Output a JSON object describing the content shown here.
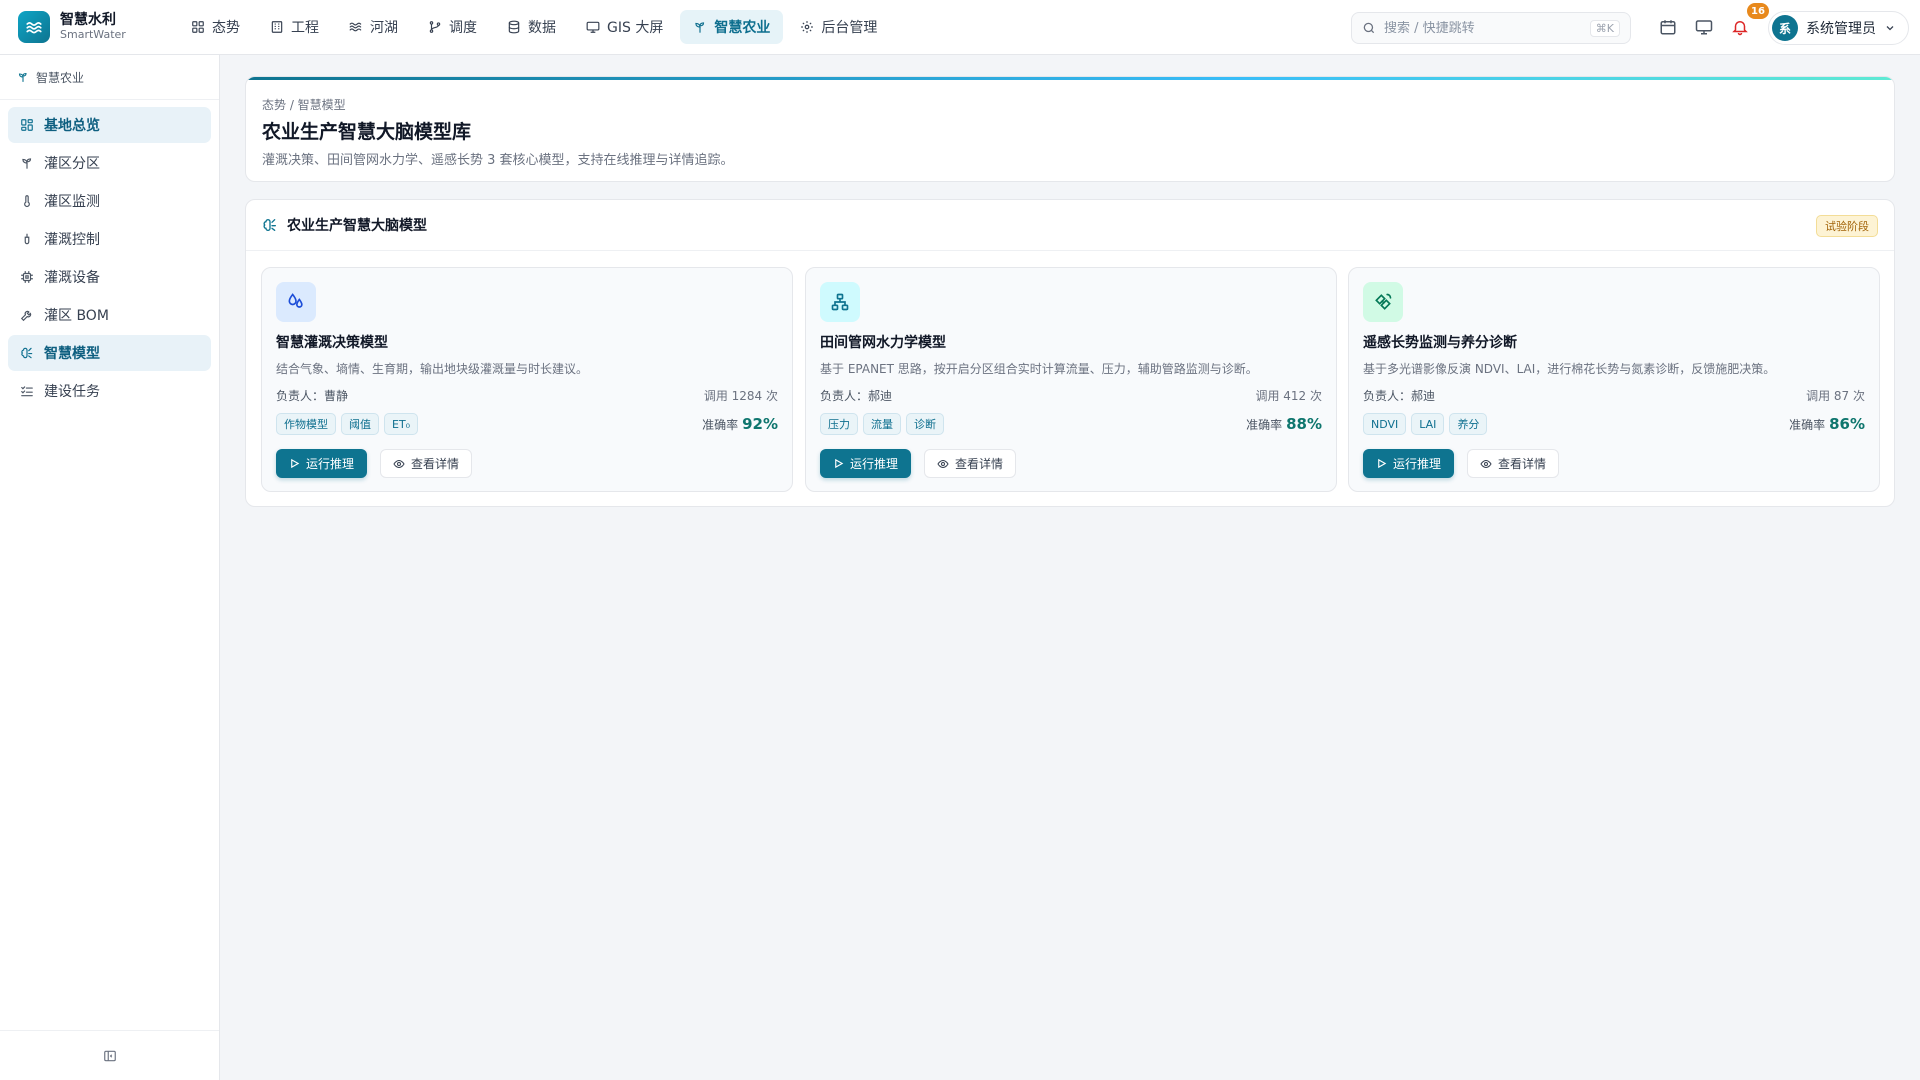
{
  "brand": {
    "name": "智慧水利",
    "sub": "SmartWater"
  },
  "nav": [
    {
      "label": "态势",
      "icon": "grid-icon"
    },
    {
      "label": "工程",
      "icon": "building-icon"
    },
    {
      "label": "河湖",
      "icon": "waves-icon"
    },
    {
      "label": "调度",
      "icon": "git-branch-icon"
    },
    {
      "label": "数据",
      "icon": "database-icon"
    },
    {
      "label": "GIS 大屏",
      "icon": "monitor-icon"
    },
    {
      "label": "智慧农业",
      "icon": "sprout-icon",
      "active": true
    },
    {
      "label": "后台管理",
      "icon": "gear-icon"
    }
  ],
  "search": {
    "placeholder": "搜索 / 快捷跳转",
    "shortcut": "⌘K"
  },
  "notifications": {
    "count": "16"
  },
  "user": {
    "avatar_char": "系",
    "name": "系统管理员"
  },
  "sidebar": {
    "title": "智慧农业",
    "items": [
      {
        "label": "基地总览",
        "icon": "dashboard-icon",
        "active": true
      },
      {
        "label": "灌区分区",
        "icon": "sprout-icon"
      },
      {
        "label": "灌区监测",
        "icon": "thermometer-icon"
      },
      {
        "label": "灌溉控制",
        "icon": "valve-icon"
      },
      {
        "label": "灌溉设备",
        "icon": "chip-icon"
      },
      {
        "label": "灌区 BOM",
        "icon": "wrench-icon"
      },
      {
        "label": "智慧模型",
        "icon": "brain-icon",
        "active": true
      },
      {
        "label": "建设任务",
        "icon": "checklist-icon"
      }
    ]
  },
  "hero": {
    "breadcrumb": "态势 / 智慧模型",
    "title": "农业生产智慧大脑模型库",
    "description": "灌溉决策、田间管网水力学、遥感长势 3 套核心模型，支持在线推理与详情追踪。"
  },
  "panel": {
    "title": "农业生产智慧大脑模型",
    "stage": "试验阶段"
  },
  "cards": [
    {
      "title": "智慧灌溉决策模型",
      "description": "结合气象、墒情、生育期，输出地块级灌溉量与时长建议。",
      "owner": "负责人：曹静",
      "calls": "调用 1284 次",
      "tags": [
        "作物模型",
        "阈值",
        "ET₀"
      ],
      "accuracy_label": "准确率",
      "accuracy_value": "92%",
      "run_label": "运行推理",
      "detail_label": "查看详情",
      "icon": "droplets-icon",
      "icon_bg": "#dbeafe",
      "icon_color": "#1d4ed8"
    },
    {
      "title": "田间管网水力学模型",
      "description": "基于 EPANET 思路，按开启分区组合实时计算流量、压力，辅助管路监测与诊断。",
      "owner": "负责人：郝迪",
      "calls": "调用 412 次",
      "tags": [
        "压力",
        "流量",
        "诊断"
      ],
      "accuracy_label": "准确率",
      "accuracy_value": "88%",
      "run_label": "运行推理",
      "detail_label": "查看详情",
      "icon": "network-icon",
      "icon_bg": "#cffafe",
      "icon_color": "#0e7490"
    },
    {
      "title": "遥感长势监测与养分诊断",
      "description": "基于多光谱影像反演 NDVI、LAI，进行棉花长势与氮素诊断，反馈施肥决策。",
      "owner": "负责人：郝迪",
      "calls": "调用 87 次",
      "tags": [
        "NDVI",
        "LAI",
        "养分"
      ],
      "accuracy_label": "准确率",
      "accuracy_value": "86%",
      "run_label": "运行推理",
      "detail_label": "查看详情",
      "icon": "satellite-icon",
      "icon_bg": "#d1fae5",
      "icon_color": "#047857"
    }
  ],
  "colors": {
    "accent": "#0e7490",
    "accent_soft": "#e6f3f8",
    "badge": "#e8891c",
    "success": "#0f766e"
  }
}
